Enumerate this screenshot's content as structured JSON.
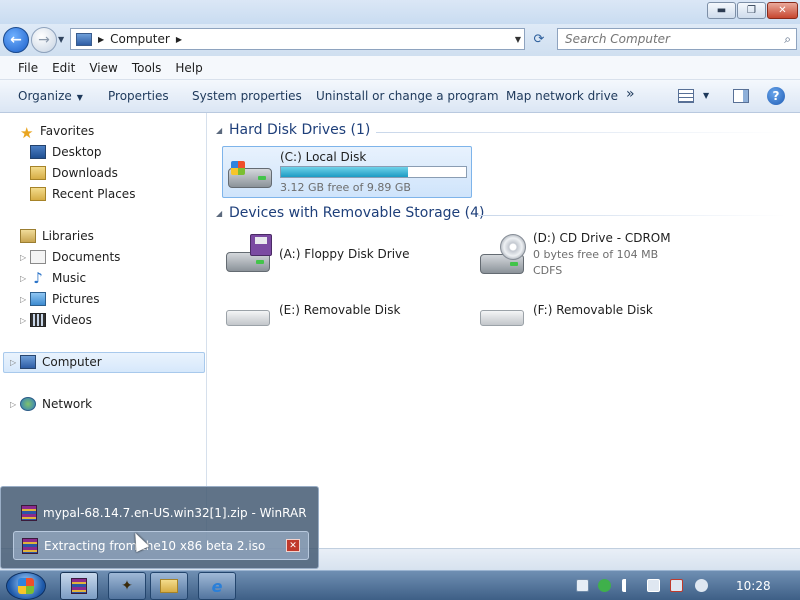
{
  "window": {
    "controls": {
      "minimize": "▬",
      "maximize": "❐",
      "close": "✕"
    }
  },
  "navbar": {
    "location": "Computer",
    "search_placeholder": "Search Computer"
  },
  "menu": [
    "File",
    "Edit",
    "View",
    "Tools",
    "Help"
  ],
  "commands": {
    "organize": "Organize",
    "properties": "Properties",
    "system_properties": "System properties",
    "uninstall": "Uninstall or change a program",
    "map_drive": "Map network drive",
    "more": "»"
  },
  "navpane": {
    "favorites": "Favorites",
    "desktop": "Desktop",
    "downloads": "Downloads",
    "recent_places": "Recent Places",
    "libraries": "Libraries",
    "documents": "Documents",
    "music": "Music",
    "pictures": "Pictures",
    "videos": "Videos",
    "computer": "Computer",
    "network": "Network"
  },
  "groups": {
    "hard_disks": "Hard Disk Drives (1)",
    "removable": "Devices with Removable Storage (4)"
  },
  "drives": {
    "c": {
      "name": "(C:) Local Disk",
      "free": "3.12 GB free of 9.89 GB",
      "used_fraction": 0.685
    },
    "a": {
      "name": "(A:) Floppy Disk Drive"
    },
    "d": {
      "name": "(D:) CD Drive - CDROM",
      "free": "0 bytes free of 104 MB",
      "fs": "CDFS"
    },
    "e": {
      "name": "(E:) Removable Disk"
    },
    "f": {
      "name": "(F:) Removable Disk"
    }
  },
  "popup": {
    "title": "mypal-68.14.7.en-US.win32[1].zip - WinRAR",
    "extracting": "Extracting from the10 x86 beta 2.iso",
    "close": "✕"
  },
  "taskbar": {
    "clock": "10:28"
  }
}
